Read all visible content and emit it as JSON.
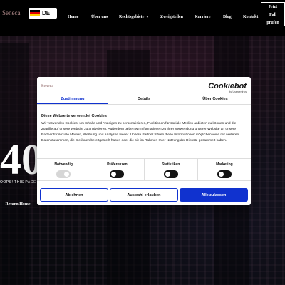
{
  "header": {
    "logo_text": "Seneca",
    "language_code": "DE",
    "flag_colors": [
      "#000000",
      "#dd0000",
      "#ffce00"
    ],
    "nav": [
      {
        "label": "Home"
      },
      {
        "label": "Über uns"
      },
      {
        "label": "Rechtsgebiete",
        "has_dropdown": true
      },
      {
        "label": "Zweigstellen"
      },
      {
        "label": "Karriere"
      },
      {
        "label": "Blog"
      },
      {
        "label": "Kontakt"
      }
    ],
    "cta_lines": [
      "Jetzt",
      "Fall",
      "prüfen"
    ]
  },
  "error": {
    "code_visible": "40",
    "message": "OOPS! THIS PAGE CAN'T",
    "return_label": "Return Home"
  },
  "cookie_dialog": {
    "logo_text": "Seneca",
    "brand": "Cookiebot",
    "brand_sub": "by Usercentrics",
    "tabs": [
      "Zustimmung",
      "Details",
      "Über Cookies"
    ],
    "active_tab": 0,
    "heading": "Diese Webseite verwendet Cookies",
    "body": "Wir verwenden Cookies, um Inhalte und Anzeigen zu personalisieren, Funktionen für soziale Medien anbieten zu können und die Zugriffe auf unsere Website zu analysieren. Außerdem geben wir Informationen zu Ihrer Verwendung unserer Website an unsere Partner für soziale Medien, Werbung und Analysen weiter. Unsere Partner führen diese Informationen möglicherweise mit weiteren Daten zusammen, die Sie ihnen bereitgestellt haben oder die sie im Rahmen Ihrer Nutzung der Dienste gesammelt haben.",
    "toggles": [
      {
        "label": "Notwendig",
        "state": "disabled-on"
      },
      {
        "label": "Präferenzen",
        "state": "off"
      },
      {
        "label": "Statistiken",
        "state": "off"
      },
      {
        "label": "Marketing",
        "state": "off"
      }
    ],
    "buttons": {
      "deny": "Ablehnen",
      "allow_selection": "Auswahl erlauben",
      "allow_all": "Alle zulassen"
    },
    "accent_color": "#1032cf"
  }
}
